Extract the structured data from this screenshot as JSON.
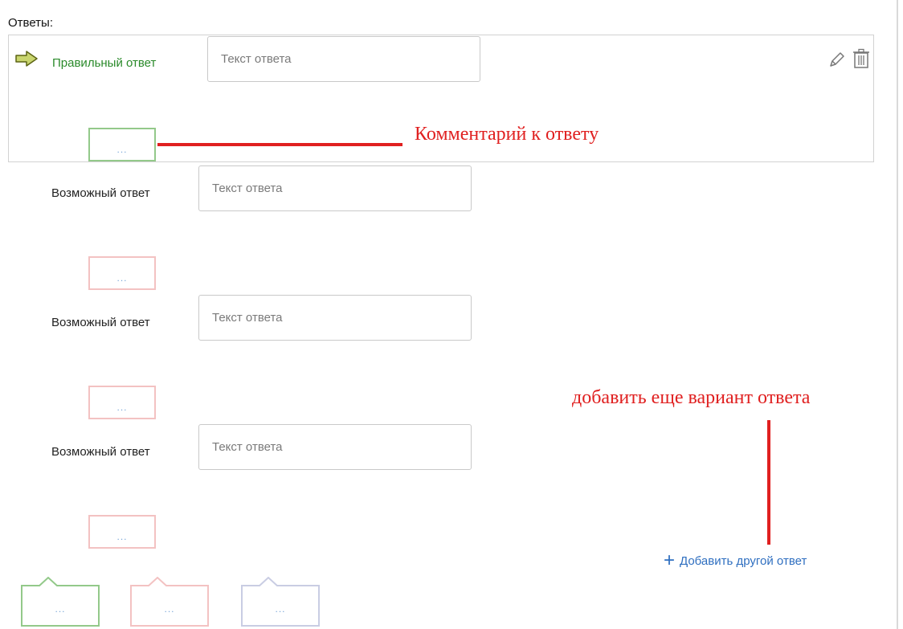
{
  "title": "Ответы:",
  "correct_answer": {
    "label": "Правильный ответ",
    "input_placeholder": "Текст ответа",
    "comment_button": "..."
  },
  "possible_answers": [
    {
      "label": "Возможный ответ",
      "input_placeholder": "Текст ответа",
      "comment_button": "..."
    },
    {
      "label": "Возможный ответ",
      "input_placeholder": "Текст ответа",
      "comment_button": "..."
    },
    {
      "label": "Возможный ответ",
      "input_placeholder": "Текст ответа",
      "comment_button": "..."
    }
  ],
  "annotations": {
    "comment": "Комментарий к ответу",
    "add_variant": "добавить еще вариант ответа"
  },
  "add_link": {
    "icon": "plus-icon",
    "label": "Добавить другой ответ"
  },
  "bottom_buttons": [
    {
      "label": "...",
      "color": "#93c98a"
    },
    {
      "label": "...",
      "color": "#f3c2c2"
    },
    {
      "label": "...",
      "color": "#c9cde3"
    }
  ],
  "colors": {
    "correct_text": "#2a8a2a",
    "annotation": "#e02020",
    "link": "#2f6fc0",
    "comment_border_correct": "#93c98a",
    "comment_border_possible": "#f3c2c2"
  }
}
